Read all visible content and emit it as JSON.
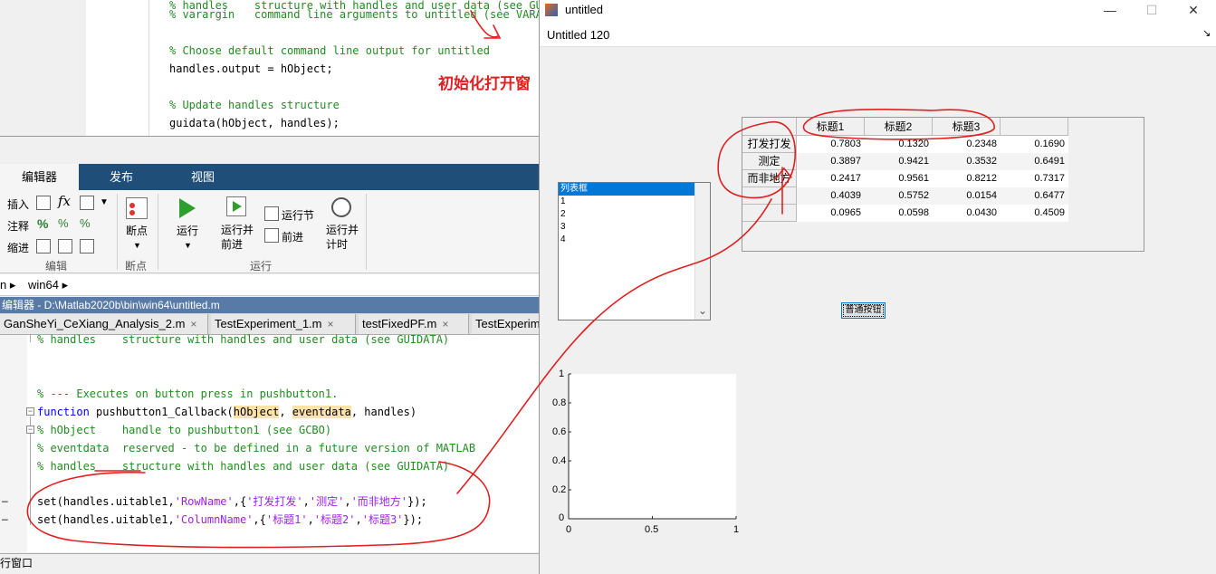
{
  "bg_editor": {
    "lines": [
      "% handles    structure with handles and user data (see GUIDATA)",
      "% varargin   command line arguments to untitled (see VARARGIN)",
      "",
      "% Choose default command line output for untitled",
      "handles.output = hObject;",
      "",
      "% Update handles structure",
      "guidata(hObject, handles);"
    ]
  },
  "annotation_text": "初始化打开窗",
  "ribbon": {
    "tabs": [
      "编辑器",
      "发布",
      "视图"
    ],
    "edit_group": {
      "insert": "插入",
      "comment": "注释",
      "indent": "缩进",
      "fx": "fx",
      "label": "编辑"
    },
    "breakpoint": {
      "label": "断点",
      "group": "断点"
    },
    "run": {
      "run": "运行",
      "run_advance": "运行并\n前进",
      "run_section": "运行节",
      "advance": "前进",
      "run_time": "运行并\n计时",
      "group": "运行"
    }
  },
  "address": {
    "prefix": "n ▸",
    "folder": "win64 ▸"
  },
  "editor": {
    "title": "编辑器 - D:\\Matlab2020b\\bin\\win64\\untitled.m",
    "tabs": [
      "GanSheYi_CeXiang_Analysis_2.m",
      "TestExperiment_1.m",
      "testFixedPF.m",
      "TestExperim"
    ],
    "tab_close": "×",
    "code": {
      "l0": "% handles    structure with handles and user data (see GUIDATA)",
      "l1": "% --- Executes on button press in pushbutton1.",
      "l2_kw": "function",
      "l2_a": " pushbutton1_Callback(",
      "l2_h1": "hObject",
      "l2_b": ", ",
      "l2_h2": "eventdata",
      "l2_c": ", handles)",
      "l3": "% hObject    handle to pushbutton1 (see GCBO)",
      "l4": "% eventdata  reserved - to be defined in a future version of MATLAB",
      "l5": "% handles    structure with handles and user data (see GUIDATA)",
      "l6_a": "set(handles.uitable1,",
      "l6_s1": "'RowName'",
      "l6_b": ",{",
      "l6_s2": "'打发打发'",
      "l6_c": ",",
      "l6_s3": "'测定'",
      "l6_d": ",",
      "l6_s4": "'而非地方'",
      "l6_e": "});",
      "l7_a": "set(handles.uitable1,",
      "l7_s1": "'ColumnName'",
      "l7_b": ",{",
      "l7_s2": "'标题1'",
      "l7_c": ",",
      "l7_s3": "'标题2'",
      "l7_d": ",",
      "l7_s4": "'标题3'",
      "l7_e": "});"
    },
    "gutter_marks": [
      "–",
      "–"
    ]
  },
  "command_window": {
    "label": "行窗口"
  },
  "figure": {
    "title": "untitled",
    "menu_text": "Untitled 120",
    "menu_arrow": "↘",
    "controls": {
      "minimize": "—",
      "maximize": "☐",
      "close": "✕"
    },
    "listbox": {
      "items": [
        "列表框",
        "1",
        "2",
        "3",
        "4"
      ],
      "selected_index": 0,
      "scroll_arrow": "⌄"
    },
    "uitable": {
      "column_names": [
        "标题1",
        "标题2",
        "标题3",
        ""
      ],
      "row_names": [
        "打发打发",
        "测定",
        "而非地方",
        "",
        ""
      ],
      "rows": [
        [
          "0.7803",
          "0.1320",
          "0.2348",
          "0.1690"
        ],
        [
          "0.3897",
          "0.9421",
          "0.3532",
          "0.6491"
        ],
        [
          "0.2417",
          "0.9561",
          "0.8212",
          "0.7317"
        ],
        [
          "0.4039",
          "0.5752",
          "0.0154",
          "0.6477"
        ],
        [
          "0.0965",
          "0.0598",
          "0.0430",
          "0.4509"
        ]
      ]
    },
    "button_label": "普通按钮",
    "axes": {
      "y_ticks": [
        "1",
        "0.8",
        "0.6",
        "0.4",
        "0.2",
        "0"
      ],
      "x_ticks": [
        "0",
        "0.5",
        "1"
      ]
    }
  },
  "colors": {
    "ribbon_blue": "#1f4e79",
    "annotation_red": "#e02020",
    "selection_blue": "#0078d7"
  }
}
